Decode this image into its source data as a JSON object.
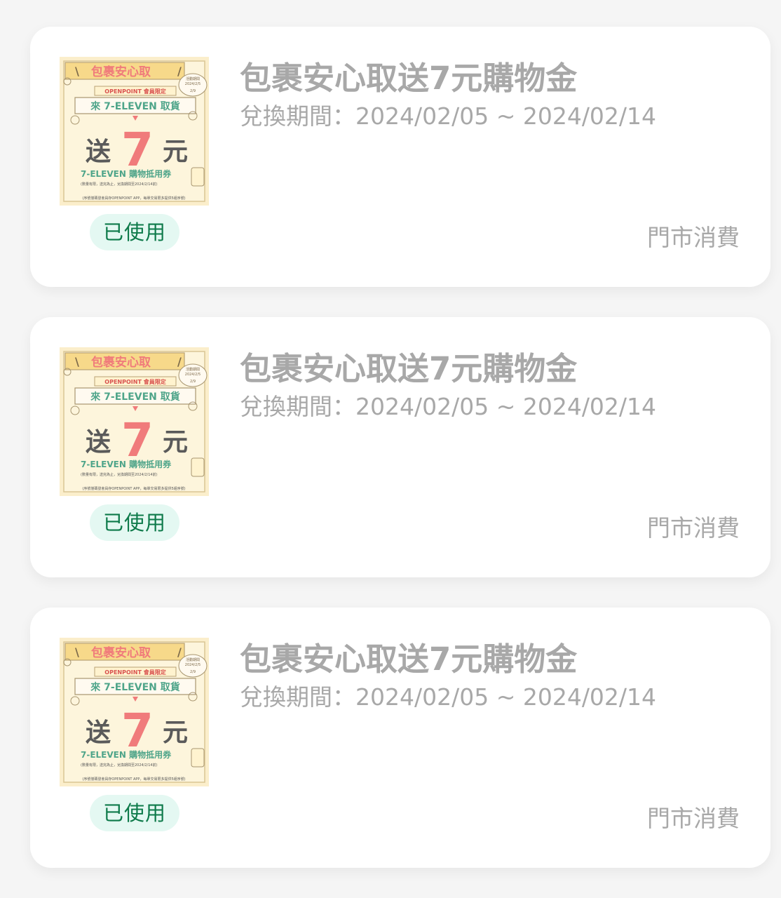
{
  "coupons": [
    {
      "title": "包裹安心取送7元購物金",
      "period": "兌換期間：2024/02/05 ~ 2024/02/14",
      "status": "已使用",
      "category": "門市消費",
      "banner": {
        "headline": "包裹安心取",
        "member": "OPENPOINT 會員限定",
        "pickup": "來 7-ELEVEN 取貨",
        "give": "送",
        "amount": "7",
        "unit": "元",
        "voucher": "7-ELEVEN 購物抵用券",
        "note": "(數量有限，送完為止，兌換期間至2024/2/14前)",
        "footer": "(序號僅碼發會員存OPENPOINT APP，每單交易限多提供5組序號)",
        "activity_label": "活動期間",
        "activity_start": "2024/2/5",
        "activity_end": "2/9"
      }
    },
    {
      "title": "包裹安心取送7元購物金",
      "period": "兌換期間：2024/02/05 ~ 2024/02/14",
      "status": "已使用",
      "category": "門市消費",
      "banner": {
        "headline": "包裹安心取",
        "member": "OPENPOINT 會員限定",
        "pickup": "來 7-ELEVEN 取貨",
        "give": "送",
        "amount": "7",
        "unit": "元",
        "voucher": "7-ELEVEN 購物抵用券",
        "note": "(數量有限，送完為止，兌換期間至2024/2/14前)",
        "footer": "(序號僅碼發會員存OPENPOINT APP，每單交易限多提供5組序號)",
        "activity_label": "活動期間",
        "activity_start": "2024/2/5",
        "activity_end": "2/9"
      }
    },
    {
      "title": "包裹安心取送7元購物金",
      "period": "兌換期間：2024/02/05 ~ 2024/02/14",
      "status": "已使用",
      "category": "門市消費",
      "banner": {
        "headline": "包裹安心取",
        "member": "OPENPOINT 會員限定",
        "pickup": "來 7-ELEVEN 取貨",
        "give": "送",
        "amount": "7",
        "unit": "元",
        "voucher": "7-ELEVEN 購物抵用券",
        "note": "(數量有限，送完為止，兌換期間至2024/2/14前)",
        "footer": "(序號僅碼發會員存OPENPOINT APP，每單交易限多提供5組序號)",
        "activity_label": "活動期間",
        "activity_start": "2024/2/5",
        "activity_end": "2/9"
      }
    }
  ]
}
